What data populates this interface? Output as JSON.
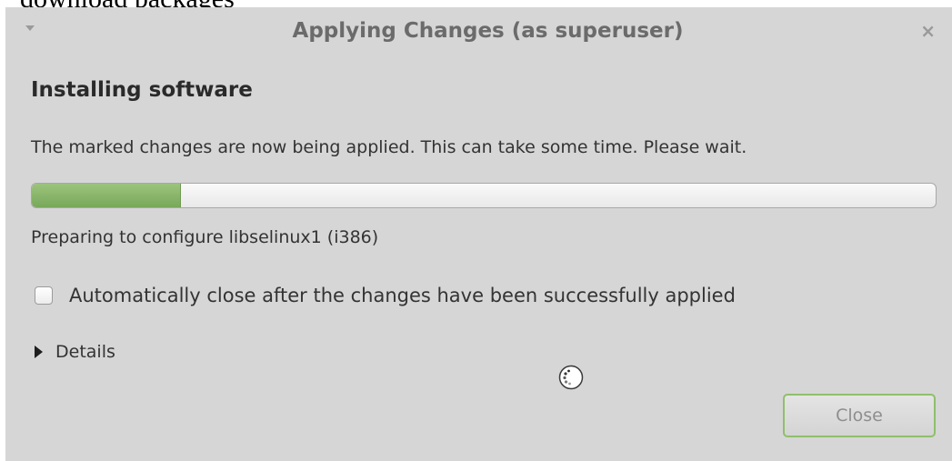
{
  "background_text": "download packages",
  "window": {
    "title": "Applying Changes (as superuser)",
    "menu_icon": "chevron-down-icon",
    "close_icon": "close-icon",
    "close_glyph": "×"
  },
  "content": {
    "heading": "Installing software",
    "message": "The marked changes are now being applied. This can take some time. Please wait.",
    "progress_fraction": 0.165,
    "status": "Preparing to configure libselinux1 (i386)",
    "autoclose_label": "Automatically close after the changes have been successfully applied",
    "autoclose_checked": false,
    "details_label": "Details",
    "spinner_icon": "busy-spinner-icon"
  },
  "buttons": {
    "close_label": "Close"
  },
  "colors": {
    "progress_fill": "#86b064",
    "close_button_border": "#8fbf6c"
  }
}
